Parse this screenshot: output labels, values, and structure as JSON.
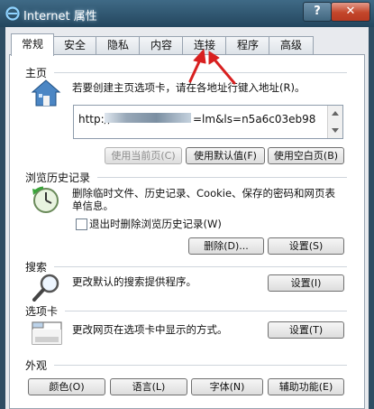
{
  "window": {
    "title": "Internet 属性",
    "help_label": "?",
    "close_label": "✕"
  },
  "tabs": [
    {
      "label": "常规",
      "active": true
    },
    {
      "label": "安全"
    },
    {
      "label": "隐私"
    },
    {
      "label": "内容"
    },
    {
      "label": "连接"
    },
    {
      "label": "程序"
    },
    {
      "label": "高级"
    }
  ],
  "home": {
    "heading": "主页",
    "desc": "若要创建主页选项卡，请在各地址行键入地址(R)。",
    "url_prefix": "http://",
    "url_suffix": "=lm&ls=n5a6c03eb98",
    "use_current": "使用当前页(C)",
    "use_default": "使用默认值(F)",
    "use_blank": "使用空白页(B)"
  },
  "history": {
    "heading": "浏览历史记录",
    "desc": "删除临时文件、历史记录、Cookie、保存的密码和网页表单信息。",
    "checkbox_label": "退出时删除浏览历史记录(W)",
    "delete_btn": "删除(D)...",
    "settings_btn": "设置(S)"
  },
  "search": {
    "heading": "搜索",
    "desc": "更改默认的搜索提供程序。",
    "settings_btn": "设置(I)"
  },
  "tabs_section": {
    "heading": "选项卡",
    "desc": "更改网页在选项卡中显示的方式。",
    "settings_btn": "设置(T)"
  },
  "appearance": {
    "heading": "外观",
    "colors": "颜色(O)",
    "languages": "语言(L)",
    "fonts": "字体(N)",
    "accessibility": "辅助功能(E)"
  },
  "colors": {
    "annotation_arrow": "#d82020"
  }
}
